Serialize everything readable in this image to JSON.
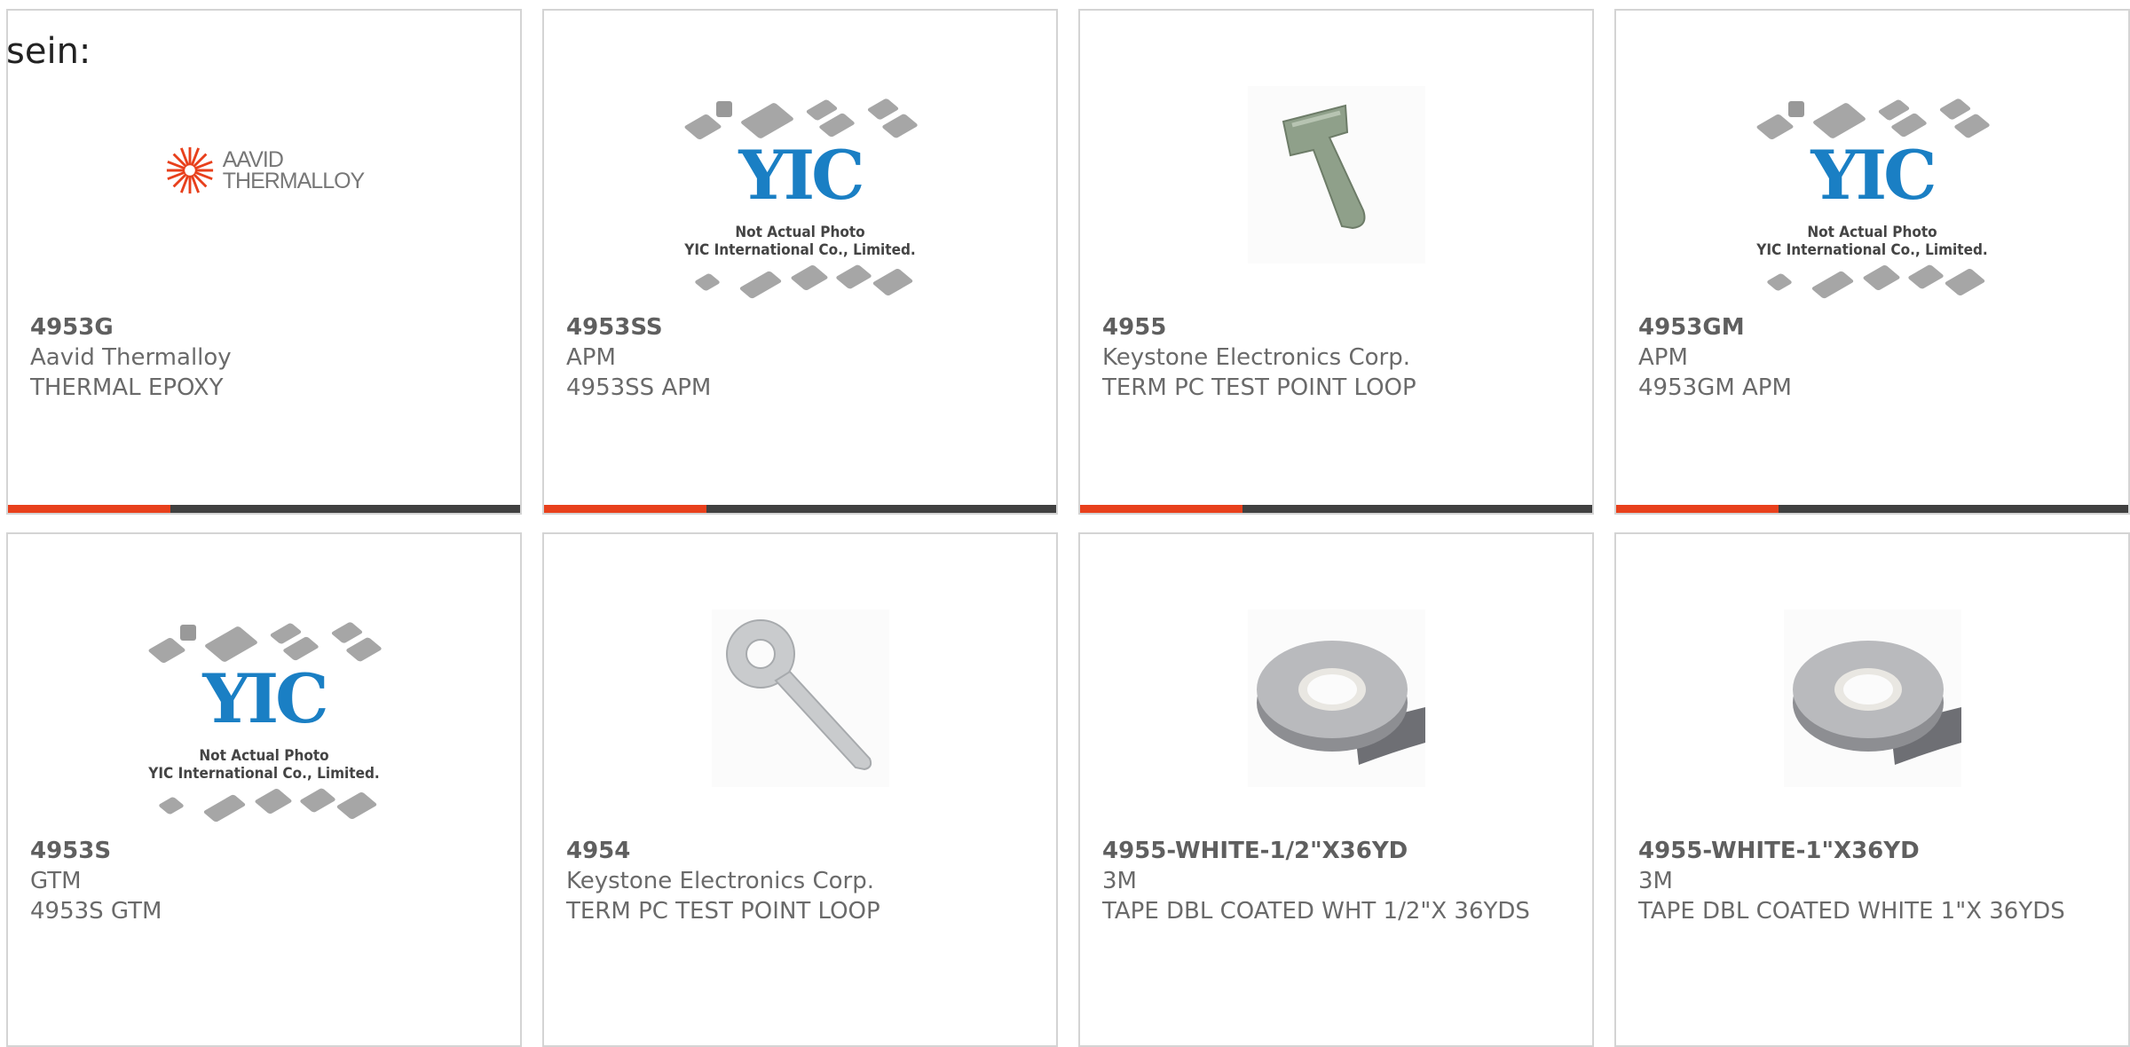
{
  "header": {
    "text": "sein:"
  },
  "products": [
    {
      "part": "4953G",
      "maker": "Aavid Thermalloy",
      "desc": "THERMAL EPOXY",
      "image": "aavid-thermalloy-logo"
    },
    {
      "part": "4953SS",
      "maker": "APM",
      "desc": "4953SS APM",
      "image": "not-actual-photo"
    },
    {
      "part": "4955",
      "maker": "Keystone Electronics Corp.",
      "desc": "TERM PC TEST POINT LOOP",
      "image": "test-point-tab"
    },
    {
      "part": "4953GM",
      "maker": "APM",
      "desc": "4953GM APM",
      "image": "not-actual-photo"
    },
    {
      "part": "4953S",
      "maker": "GTM",
      "desc": "4953S GTM",
      "image": "not-actual-photo"
    },
    {
      "part": "4954",
      "maker": "Keystone Electronics Corp.",
      "desc": "TERM PC TEST POINT LOOP",
      "image": "test-point-loop"
    },
    {
      "part": "4955-WHITE-1/2\"X36YD",
      "maker": "3M",
      "desc": "TAPE DBL COATED WHT 1/2\"X 36YDS",
      "image": "tape-roll"
    },
    {
      "part": "4955-WHITE-1\"X36YD",
      "maker": "3M",
      "desc": "TAPE DBL COATED WHITE 1\"X 36YDS",
      "image": "tape-roll"
    }
  ],
  "placeholder": {
    "logo": "YIC",
    "caption1": "Not Actual Photo",
    "caption2": "YIC International Co., Limited."
  },
  "aavid_logo": {
    "line1": "AAVID",
    "line2": "THERMALLOY"
  },
  "colors": {
    "accent": "#e8401c",
    "bar": "#404040",
    "border": "#d4d4d4",
    "yic_blue": "#1a7fc4"
  }
}
